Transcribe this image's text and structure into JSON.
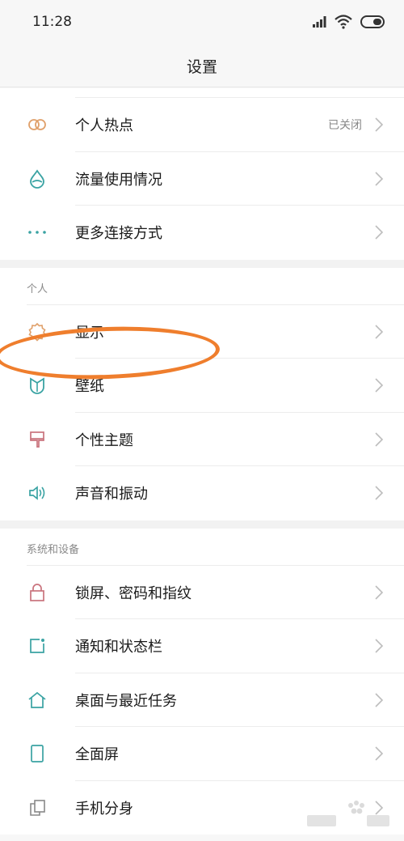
{
  "status_bar": {
    "time": "11:28"
  },
  "header": {
    "title": "设置"
  },
  "section_connectivity": {
    "items": [
      {
        "label": "个人热点",
        "value": "已关闭",
        "icon": "hotspot-icon"
      },
      {
        "label": "流量使用情况",
        "icon": "data-usage-icon"
      },
      {
        "label": "更多连接方式",
        "icon": "more-dots-icon"
      }
    ]
  },
  "section_personal": {
    "title": "个人",
    "items": [
      {
        "label": "显示",
        "icon": "display-icon"
      },
      {
        "label": "壁纸",
        "icon": "wallpaper-icon"
      },
      {
        "label": "个性主题",
        "icon": "theme-brush-icon"
      },
      {
        "label": "声音和振动",
        "icon": "speaker-icon"
      }
    ]
  },
  "section_system": {
    "title": "系统和设备",
    "items": [
      {
        "label": "锁屏、密码和指纹",
        "icon": "lock-icon"
      },
      {
        "label": "通知和状态栏",
        "icon": "notification-icon"
      },
      {
        "label": "桌面与最近任务",
        "icon": "home-icon"
      },
      {
        "label": "全面屏",
        "icon": "fullscreen-phone-icon"
      },
      {
        "label": "手机分身",
        "icon": "clone-icon"
      }
    ]
  },
  "colors": {
    "accent_highlight": "#ef7e2d",
    "icon_orange": "#e0a06a",
    "icon_teal": "#3aa3a3",
    "icon_pink": "#c9737d"
  }
}
